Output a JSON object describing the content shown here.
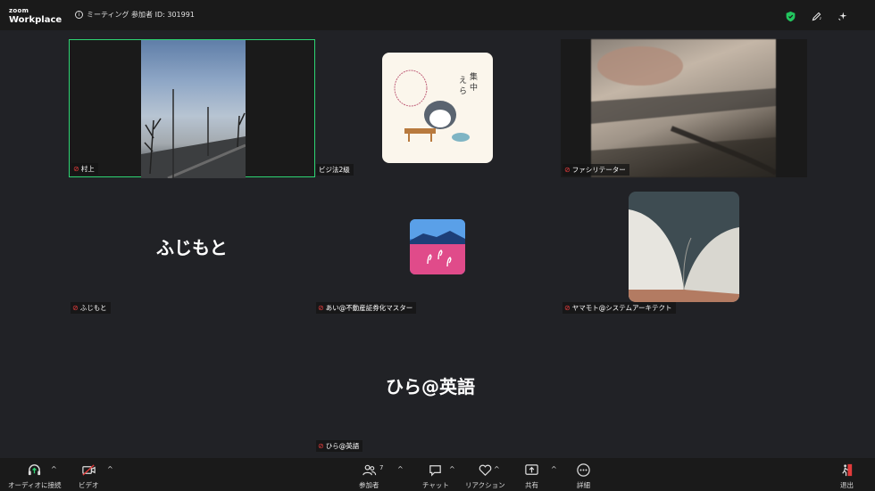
{
  "app": {
    "logo_line1": "zoom",
    "logo_line2": "Workplace",
    "meeting_info": "ミーティング 参加者 ID: 301991"
  },
  "participants": {
    "p1": {
      "name": "村上",
      "muted": true
    },
    "p2": {
      "name": "ビジ法2級",
      "muted": false
    },
    "p3": {
      "name": "ファシリテーター",
      "muted": true
    },
    "p4": {
      "name": "ふじもと",
      "display": "ふじもと",
      "muted": true
    },
    "p5": {
      "name": "あい@不動産証券化マスター",
      "muted": true
    },
    "p6": {
      "name": "ヤマモト@システムアーキテクト",
      "muted": true
    },
    "p7": {
      "name": "ひら@英語",
      "display": "ひら@英語",
      "muted": true
    }
  },
  "toolbar": {
    "audio": "オーディオに接続",
    "video": "ビデオ",
    "participants": "参加者",
    "participants_count": "7",
    "chat": "チャット",
    "reactions": "リアクション",
    "share": "共有",
    "more": "詳細",
    "leave": "退出"
  },
  "colors": {
    "active_speaker": "#2ed573",
    "muted_icon": "#e23b3b",
    "leave": "#e23b3b",
    "shield": "#22c55e"
  }
}
